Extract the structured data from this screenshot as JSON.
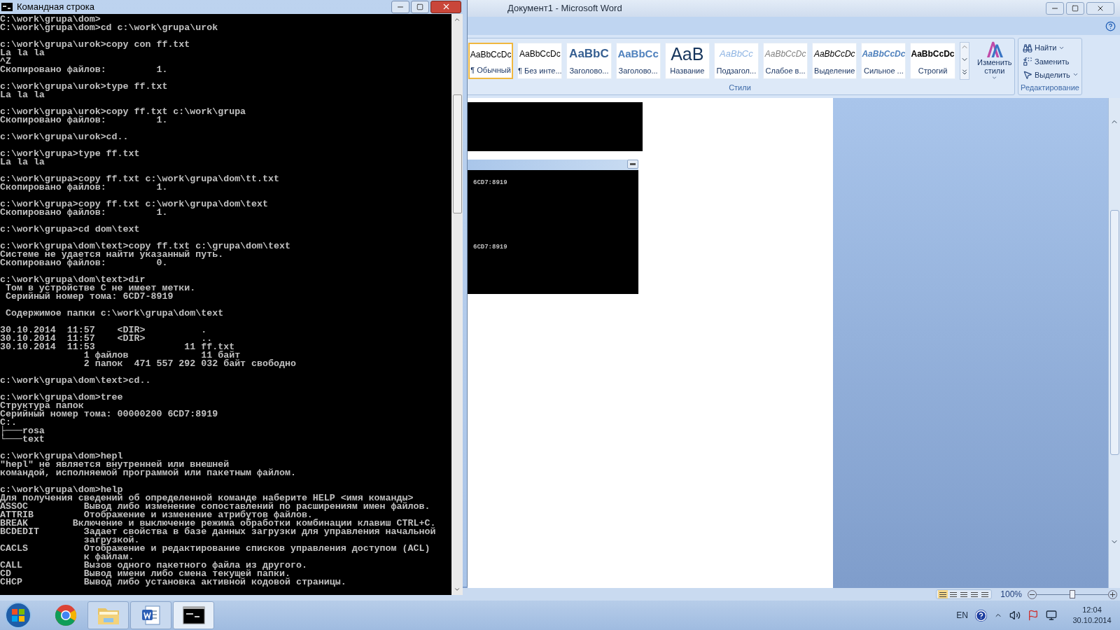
{
  "console": {
    "title": "Командная строка",
    "blocks": [
      [
        "C:\\work\\grupa\\dom>",
        "C:\\work\\grupa\\dom>cd c:\\work\\grupa\\urok"
      ],
      [
        "c:\\work\\grupa\\urok>copy con ff.txt",
        "La la la",
        "^Z",
        "Скопировано файлов:         1."
      ],
      [
        "c:\\work\\grupa\\urok>type ff.txt",
        "La la la"
      ],
      [
        "c:\\work\\grupa\\urok>copy ff.txt c:\\work\\grupa",
        "Скопировано файлов:         1."
      ],
      [
        "c:\\work\\grupa\\urok>cd.."
      ],
      [
        "c:\\work\\grupa>type ff.txt",
        "La la la"
      ],
      [
        "c:\\work\\grupa>copy ff.txt c:\\work\\grupa\\dom\\tt.txt",
        "Скопировано файлов:         1."
      ],
      [
        "c:\\work\\grupa>copy ff.txt c:\\work\\grupa\\dom\\text",
        "Скопировано файлов:         1."
      ],
      [
        "c:\\work\\grupa>cd dom\\text"
      ],
      [
        "c:\\work\\grupa\\dom\\text>copy ff.txt c:\\grupa\\dom\\text",
        "Системе не удается найти указанный путь.",
        "Скопировано файлов:         0."
      ],
      [
        "c:\\work\\grupa\\dom\\text>dir",
        " Том в устройстве C не имеет метки.",
        " Серийный номер тома: 6CD7-8919"
      ],
      [
        " Содержимое папки c:\\work\\grupa\\dom\\text"
      ],
      [
        "30.10.2014  11:57    <DIR>          .",
        "30.10.2014  11:57    <DIR>          ..",
        "30.10.2014  11:53                11 ff.txt",
        "               1 файлов             11 байт",
        "               2 папок  471 557 292 032 байт свободно"
      ],
      [
        "c:\\work\\grupa\\dom\\text>cd.."
      ],
      [
        "c:\\work\\grupa\\dom>tree",
        "Структура папок",
        "Серийный номер тома: 00000200 6CD7:8919",
        "C:.",
        "├───rosa",
        "└───text"
      ],
      [
        "c:\\work\\grupa\\dom>hepl",
        "\"hepl\" не является внутренней или внешней",
        "командой, исполняемой программой или пакетным файлом."
      ],
      [
        "c:\\work\\grupa\\dom>help",
        "Для получения сведений об определенной команде наберите HELP <имя команды>",
        "ASSOC          Вывод либо изменение сопоставлений по расширениям имен файлов.",
        "ATTRIB         Отображение и изменение атрибутов файлов.",
        "BREAK        Включение и выключение режима обработки комбинации клавиш CTRL+C.",
        "BCDEDIT        Задает свойства в базе данных загрузки для управления начальной",
        "               загрузкой.",
        "CACLS          Отображение и редактирование списков управления доступом (ACL)",
        "               к файлам.",
        "CALL           Вызов одного пакетного файла из другого.",
        "CD             Вывод имени либо смена текущей папки.",
        "CHCP           Вывод либо установка активной кодовой страницы."
      ]
    ]
  },
  "word": {
    "title": "Документ1 - Microsoft Word",
    "styles": [
      {
        "kind": "normal",
        "preview": "AaBbCcDc",
        "name": "¶ Обычный",
        "selected": true
      },
      {
        "kind": "normal",
        "preview": "AaBbCcDc",
        "name": "¶ Без инте...",
        "selected": false
      },
      {
        "kind": "heading1",
        "preview": "AaBbC",
        "name": "Заголово...",
        "selected": false
      },
      {
        "kind": "heading2",
        "preview": "AaBbCc",
        "name": "Заголово...",
        "selected": false
      },
      {
        "kind": "title",
        "preview": "AaB",
        "name": "Название",
        "selected": false
      },
      {
        "kind": "subtitle",
        "preview": "AaBbCc",
        "name": "Подзагол...",
        "selected": false
      },
      {
        "kind": "subtle",
        "preview": "AaBbCcDc",
        "name": "Слабое в...",
        "selected": false
      },
      {
        "kind": "emphasis",
        "preview": "AaBbCcDc",
        "name": "Выделение",
        "selected": false
      },
      {
        "kind": "intense",
        "preview": "AaBbCcDc",
        "name": "Сильное ...",
        "selected": false
      },
      {
        "kind": "strong",
        "preview": "AaBbCcDc",
        "name": "Строгий",
        "selected": false
      }
    ],
    "styles_group": "Стили",
    "change_styles": "Изменить стили",
    "editing": [
      {
        "kind": "find",
        "label": "Найти",
        "menu": true
      },
      {
        "kind": "replace",
        "label": "Заменить",
        "menu": false
      },
      {
        "kind": "select",
        "label": "Выделить",
        "menu": true
      }
    ],
    "editing_group": "Редактирование",
    "embedded_lines": [
      "6CD7:8919",
      "6CD7:8919"
    ],
    "status": {
      "zoom": "100%"
    },
    "zoom_slider": {
      "level": 0.5
    }
  },
  "taskbar": {
    "apps": [
      {
        "kind": "chrome",
        "running": false,
        "selected": false
      },
      {
        "kind": "folder",
        "running": true,
        "selected": false
      },
      {
        "kind": "word",
        "running": true,
        "selected": false
      },
      {
        "kind": "console",
        "running": true,
        "selected": true
      }
    ],
    "language": "EN",
    "time": "12:04",
    "date": "30.10.2014"
  }
}
